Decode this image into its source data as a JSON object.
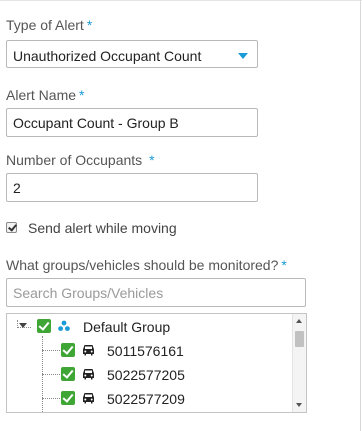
{
  "form": {
    "alert_type": {
      "label": "Type of Alert",
      "required_mark": "*",
      "selected_value": "Unauthorized Occupant Count"
    },
    "alert_name": {
      "label": "Alert Name",
      "required_mark": "*",
      "value": "Occupant Count - Group B"
    },
    "occupants": {
      "label": "Number of Occupants",
      "required_mark": "*",
      "value": "2"
    },
    "send_while_moving": {
      "label": "Send alert while moving",
      "checked": true
    },
    "monitor": {
      "label": "What groups/vehicles should be monitored?",
      "required_mark": "*",
      "search_placeholder": "Search Groups/Vehicles"
    }
  },
  "tree": {
    "group": {
      "label": "Default Group",
      "checked": true,
      "icon": "group-icon",
      "expanded": true
    },
    "vehicles": [
      {
        "label": "5011576161",
        "checked": true,
        "icon": "car-icon"
      },
      {
        "label": "5022577205",
        "checked": true,
        "icon": "car-icon"
      },
      {
        "label": "5022577209",
        "checked": true,
        "icon": "car-icon"
      }
    ]
  },
  "colors": {
    "accent": "#1a9bd7",
    "check_green": "#3fa535"
  }
}
